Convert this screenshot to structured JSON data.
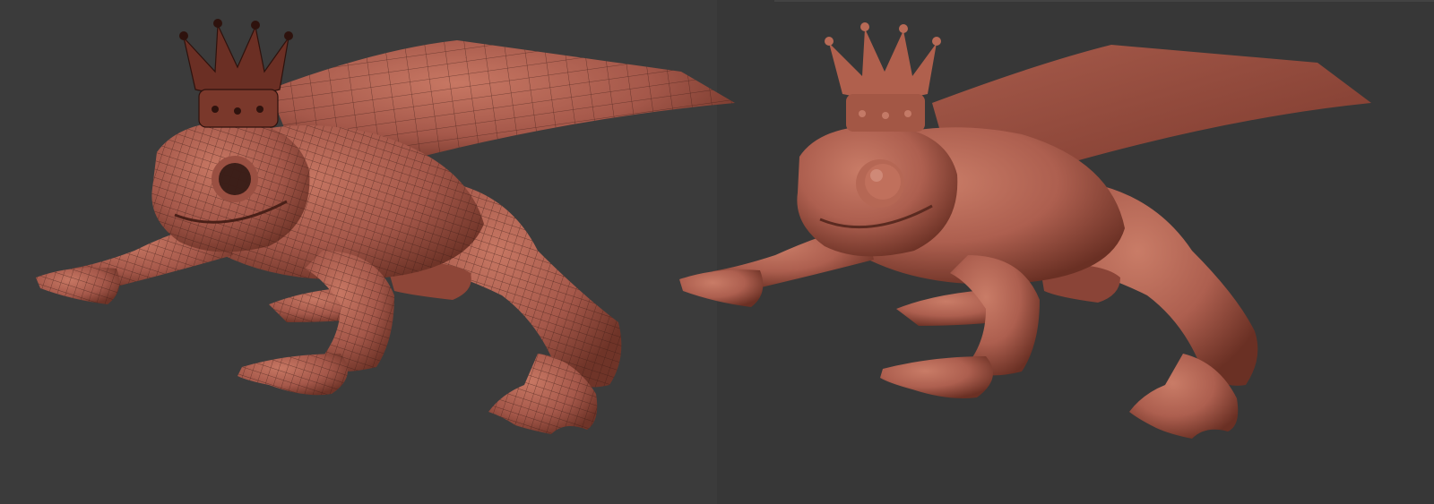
{
  "scene": {
    "background_color": "#3a3a3a",
    "model_color": "#b2624f",
    "model_shadow_color": "#6e3326",
    "crown_color": "#a85b48",
    "wire_color": "#3a1a14"
  },
  "views": [
    {
      "id": "wireframe",
      "shading": "wireframe-on-shaded"
    },
    {
      "id": "smooth",
      "shading": "smooth-shaded"
    }
  ]
}
